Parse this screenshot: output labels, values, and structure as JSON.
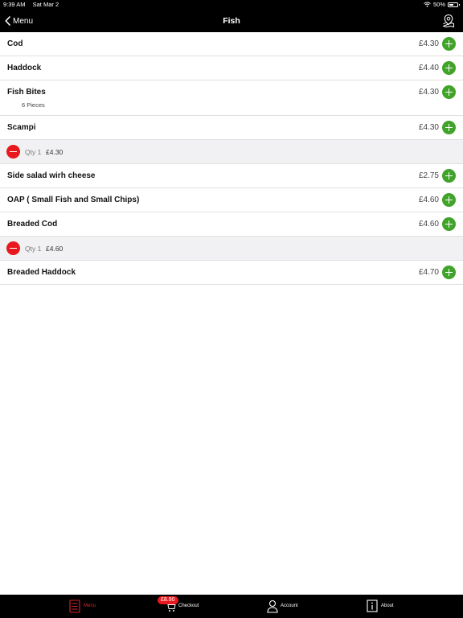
{
  "status_bar": {
    "time": "9:39 AM",
    "date": "Sat Mar 2",
    "battery": "50%",
    "battery_level": 0.5
  },
  "nav": {
    "back_label": "Menu",
    "title": "Fish"
  },
  "rows": [
    {
      "name": "Cod",
      "price": "£4.30"
    },
    {
      "name": "Haddock",
      "price": "£4.40"
    },
    {
      "name": "Fish Bites",
      "price": "£4.30",
      "sub": "6 Pieces"
    },
    {
      "name": "Scampi",
      "price": "£4.30"
    },
    {
      "qty": "Qty 1",
      "price": "£4.30"
    },
    {
      "name": "Side salad wirh cheese",
      "price": "£2.75"
    },
    {
      "name": "OAP ( Small Fish and Small Chips)",
      "price": "£4.60"
    },
    {
      "name": "Breaded Cod",
      "price": "£4.60"
    },
    {
      "qty": "Qty 1",
      "price": "£4.60"
    },
    {
      "name": "Breaded Haddock",
      "price": "£4.70"
    }
  ],
  "tabbar": {
    "menu": "Menu",
    "checkout": "Checkout",
    "checkout_badge": "£8.90",
    "account": "Account",
    "about": "About"
  },
  "colors": {
    "add": "#41a32a",
    "remove": "#e8191e",
    "active_tab": "#d6242a"
  },
  "icons": {
    "back": "chevron-left-icon",
    "map": "location-map-icon",
    "menu_tab": "menu-list-icon",
    "checkout_tab": "cart-icon",
    "account_tab": "person-icon",
    "about_tab": "info-icon"
  }
}
